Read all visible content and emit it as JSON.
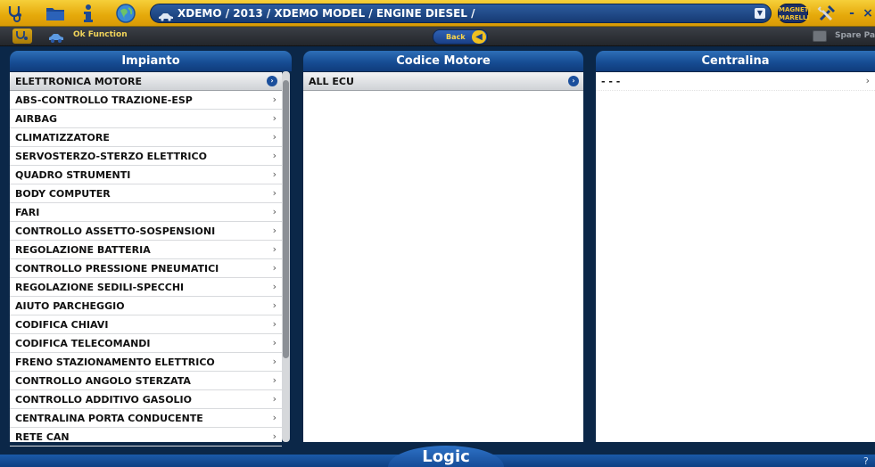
{
  "topbar": {
    "breadcrumb": "XDEMO / 2013 / XDEMO MODEL / ENGINE DIESEL /",
    "logo_text": "MAGNETI MARELLI",
    "minimize_label": "-",
    "close_label": "×"
  },
  "toolbar": {
    "ok_function_label": "Ok Function",
    "back_label": "Back",
    "spare_parts_label": "Spare Parts"
  },
  "columns": {
    "impianto": {
      "header": "Impianto",
      "items": [
        "ELETTRONICA MOTORE",
        "ABS-CONTROLLO TRAZIONE-ESP",
        "AIRBAG",
        "CLIMATIZZATORE",
        "SERVOSTERZO-STERZO ELETTRICO",
        "QUADRO STRUMENTI",
        "BODY COMPUTER",
        "FARI",
        "CONTROLLO ASSETTO-SOSPENSIONI",
        "REGOLAZIONE BATTERIA",
        "CONTROLLO PRESSIONE PNEUMATICI",
        "REGOLAZIONE SEDILI-SPECCHI",
        "AIUTO PARCHEGGIO",
        "CODIFICA CHIAVI",
        "CODIFICA TELECOMANDI",
        "FRENO STAZIONAMENTO ELETTRICO",
        "CONTROLLO ANGOLO STERZATA",
        "CONTROLLO ADDITIVO GASOLIO",
        "CENTRALINA PORTA CONDUCENTE",
        "RETE CAN"
      ],
      "selected_index": 0
    },
    "codice_motore": {
      "header": "Codice Motore",
      "items": [
        "ALL ECU"
      ],
      "selected_index": 0
    },
    "centralina": {
      "header": "Centralina",
      "items": [
        "- - -"
      ]
    }
  },
  "footer": {
    "brand": "Logic",
    "help": "?"
  },
  "colors": {
    "topbar_yellow": "#e5a90a",
    "header_blue": "#174d94",
    "background": "#0b2748"
  }
}
